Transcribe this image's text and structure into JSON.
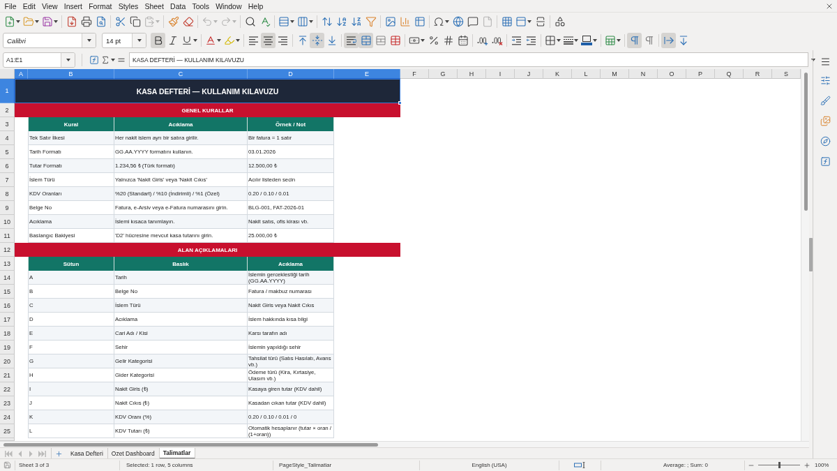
{
  "menu": [
    "File",
    "Edit",
    "View",
    "Insert",
    "Format",
    "Styles",
    "Sheet",
    "Data",
    "Tools",
    "Window",
    "Help"
  ],
  "standard_toolbar": {
    "paste_disabled": true,
    "undo_disabled": true,
    "redo_disabled": true,
    "header_footer_disabled": true
  },
  "formatting_toolbar": {
    "font_name": "Calibri",
    "font_size": "14 pt",
    "bold": true,
    "italic": false,
    "underline": false,
    "align_left": false,
    "align_center": true,
    "align_right": false,
    "align_top": false,
    "align_middle": true,
    "align_bottom": false,
    "wrap_text": true,
    "merge_and_center": true,
    "left_to_right": true,
    "right_to_left": false,
    "text_horizontal": true,
    "text_vertical": false
  },
  "formula_bar": {
    "name_box": "A1:E1",
    "content": "KASA DEFTERİ — KULLANIM KILAVUZU"
  },
  "columns": [
    {
      "label": "A",
      "selected": true
    },
    {
      "label": "B",
      "selected": true
    },
    {
      "label": "C",
      "selected": true
    },
    {
      "label": "D",
      "selected": true
    },
    {
      "label": "E",
      "selected": true
    },
    {
      "label": "F",
      "selected": false
    },
    {
      "label": "G",
      "selected": false
    },
    {
      "label": "H",
      "selected": false
    },
    {
      "label": "I",
      "selected": false
    },
    {
      "label": "J",
      "selected": false
    },
    {
      "label": "K",
      "selected": false
    },
    {
      "label": "L",
      "selected": false
    },
    {
      "label": "M",
      "selected": false
    },
    {
      "label": "N",
      "selected": false
    },
    {
      "label": "O",
      "selected": false
    },
    {
      "label": "P",
      "selected": false
    },
    {
      "label": "Q",
      "selected": false
    },
    {
      "label": "R",
      "selected": false
    },
    {
      "label": "S",
      "selected": false
    }
  ],
  "rows": [
    {
      "number": "1",
      "selected": true,
      "kind": "title",
      "text": "KASA DEFTERİ — KULLANIM KILAVUZU"
    },
    {
      "number": "2",
      "selected": false,
      "kind": "section",
      "text": "GENEL KURALLAR"
    },
    {
      "number": "3",
      "selected": false,
      "kind": "header",
      "cells": [
        "Kural",
        "Acıklama",
        "Örnek / Not"
      ]
    },
    {
      "number": "4",
      "selected": false,
      "kind": "data",
      "cells": [
        "Tek Satır İlkesi",
        "Her nakit islem ayrı bir satıra girilir.",
        "Bir fatura = 1 satır"
      ]
    },
    {
      "number": "5",
      "selected": false,
      "kind": "data",
      "cells": [
        "Tarih Formatı",
        "GG.AA.YYYY formatını kullanın.",
        "03.01.2026"
      ]
    },
    {
      "number": "6",
      "selected": false,
      "kind": "data",
      "cells": [
        "Tutar Formatı",
        "1.234,56 ₺ (Türk formatı)",
        "12.500,00 ₺"
      ]
    },
    {
      "number": "7",
      "selected": false,
      "kind": "data",
      "cells": [
        "İslem Türü",
        "Yalnızca 'Nakit Giris' veya 'Nakit Cıkıs'",
        "Acılır listeden secin"
      ]
    },
    {
      "number": "8",
      "selected": false,
      "kind": "data",
      "cells": [
        "KDV Oranları",
        "%20 (Standart) / %10 (İndirimli) / %1 (Özel)",
        "0.20 / 0.10 / 0.01"
      ]
    },
    {
      "number": "9",
      "selected": false,
      "kind": "data",
      "cells": [
        "Belge No",
        "Fatura, e-Arsiv veya e-Fatura numarasını girin.",
        "BLG-001, FAT-2026-01"
      ]
    },
    {
      "number": "10",
      "selected": false,
      "kind": "data",
      "cells": [
        "Acıklama",
        "İslemi kısaca tanımlayın.",
        "Nakit satıs, ofis kirası vb."
      ]
    },
    {
      "number": "11",
      "selected": false,
      "kind": "data",
      "cells": [
        "Baslangıc Bakiyesi",
        "'D2' hücresine mevcut kasa tutarını girin.",
        "25.000,00 ₺"
      ]
    },
    {
      "number": "12",
      "selected": false,
      "kind": "section",
      "text": "ALAN AÇIKLAMALARI"
    },
    {
      "number": "13",
      "selected": false,
      "kind": "header",
      "cells": [
        "Sütun",
        "Baslık",
        "Acıklama"
      ]
    },
    {
      "number": "14",
      "selected": false,
      "kind": "data",
      "cells": [
        "A",
        "Tarih",
        "İslemin gerceklestiği tarih (GG.AA.YYYY)"
      ]
    },
    {
      "number": "15",
      "selected": false,
      "kind": "data",
      "cells": [
        "B",
        "Belge No",
        "Fatura / makbuz numarası"
      ]
    },
    {
      "number": "16",
      "selected": false,
      "kind": "data",
      "cells": [
        "C",
        "İslem Türü",
        "Nakit Giris veya Nakit Cıkıs"
      ]
    },
    {
      "number": "17",
      "selected": false,
      "kind": "data",
      "cells": [
        "D",
        "Acıklama",
        "İslem hakkında kısa bilgi"
      ]
    },
    {
      "number": "18",
      "selected": false,
      "kind": "data",
      "cells": [
        "E",
        "Cari Adı / Kisi",
        "Karsı tarafın adı"
      ]
    },
    {
      "number": "19",
      "selected": false,
      "kind": "data",
      "cells": [
        "F",
        "Sehir",
        "İslemin yapıldığı sehir"
      ]
    },
    {
      "number": "20",
      "selected": false,
      "kind": "data",
      "cells": [
        "G",
        "Gelir Kategorisi",
        "Tahsilat türü (Satıs Hasılatı, Avans vb.)"
      ]
    },
    {
      "number": "21",
      "selected": false,
      "kind": "data",
      "cells": [
        "H",
        "Gider Kategorisi",
        "Ödeme türü (Kira, Kırtasiye, Ulasım vb.)"
      ]
    },
    {
      "number": "22",
      "selected": false,
      "kind": "data",
      "cells": [
        "I",
        "Nakit Giris (₺)",
        "Kasaya giren tutar (KDV dahil)"
      ]
    },
    {
      "number": "23",
      "selected": false,
      "kind": "data",
      "cells": [
        "J",
        "Nakit Cıkıs (₺)",
        "Kasadan cıkan tutar (KDV dahil)"
      ]
    },
    {
      "number": "24",
      "selected": false,
      "kind": "data",
      "cells": [
        "K",
        "KDV Oranı (%)",
        "0.20 / 0.10 / 0.01 / 0"
      ]
    },
    {
      "number": "25",
      "selected": false,
      "kind": "data",
      "cells": [
        "L",
        "KDV Tutarı (₺)",
        "Otomatik hesaplanır (tutar × oran / (1+oran))"
      ]
    }
  ],
  "sheet_tab_bar": {
    "navigation_disabled": true,
    "tabs": [
      {
        "label": "Kasa Defteri",
        "selected": false
      },
      {
        "label": "Ozet Dashboard",
        "selected": false
      },
      {
        "label": "Talimatlar",
        "selected": true
      }
    ]
  },
  "status_bar": {
    "sheet": "Sheet 3 of 3",
    "selection": "Selected: 1 row, 5 columns",
    "page_style": "PageStyle_Talimatlar",
    "language": "English (USA)",
    "summary": "Average: ; Sum: 0",
    "zoom_slider": {
      "level": 0.5
    },
    "zoom": "100%"
  }
}
